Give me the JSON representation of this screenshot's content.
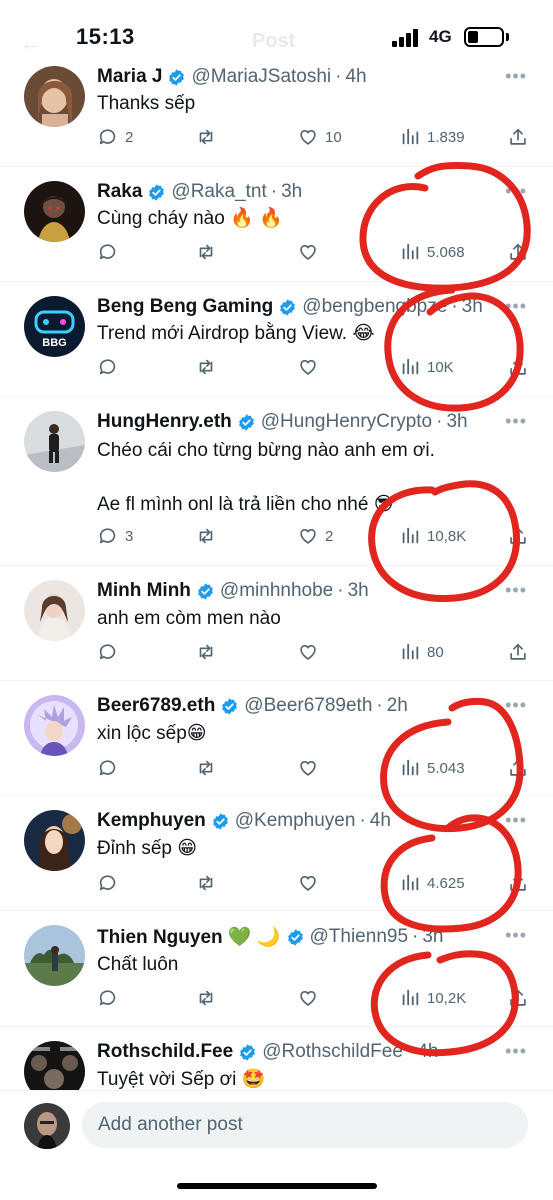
{
  "status_bar": {
    "time": "15:13",
    "network": "4G",
    "title": "Post"
  },
  "colors": {
    "verified": "#1d9bf0",
    "text": "#0f1419",
    "muted": "#536471",
    "annotation": "#e0261e"
  },
  "posts": [
    {
      "name": "Maria J",
      "handle": "@MariaJSatoshi",
      "time": "4h",
      "text": "Thanks sếp",
      "reply_count": "2",
      "repost_count": "",
      "like_count": "10",
      "views": "1.839"
    },
    {
      "name": "Raka",
      "handle": "@Raka_tnt",
      "time": "3h",
      "text": "Cùng cháy nào 🔥 🔥",
      "reply_count": "",
      "repost_count": "",
      "like_count": "",
      "views": "5.068"
    },
    {
      "name": "Beng Beng Gaming",
      "handle": "@bengbengbpze",
      "time": "3h",
      "text": "Trend mới Airdrop bằng View. 😂",
      "reply_count": "",
      "repost_count": "",
      "like_count": "",
      "views": "10K"
    },
    {
      "name": "HungHenry.eth",
      "handle": "@HungHenryCrypto",
      "time": "3h",
      "text": "Chéo cái cho từng bừng nào anh em ơi.\n\nAe fl mình onl là trả liền cho nhé 😎",
      "reply_count": "3",
      "repost_count": "",
      "like_count": "2",
      "views": "10,8K"
    },
    {
      "name": "Minh Minh",
      "handle": "@minhnhobe",
      "time": "3h",
      "text": "anh em còm men nào",
      "reply_count": "",
      "repost_count": "",
      "like_count": "",
      "views": "80"
    },
    {
      "name": "Beer6789.eth",
      "handle": "@Beer6789eth",
      "time": "2h",
      "text": "xin lộc sếp😁",
      "reply_count": "",
      "repost_count": "",
      "like_count": "",
      "views": "5.043"
    },
    {
      "name": "Kemphuyen",
      "handle": "@Kemphuyen",
      "time": "4h",
      "text": "Đỉnh sếp 😁",
      "reply_count": "",
      "repost_count": "",
      "like_count": "",
      "views": "4.625"
    },
    {
      "name": "Thien Nguyen 💚 🌙",
      "handle": "@Thienn95",
      "time": "3h",
      "text": "Chất luôn",
      "reply_count": "",
      "repost_count": "",
      "like_count": "",
      "views": "10,2K"
    },
    {
      "name": "Rothschild.Fee",
      "handle": "@RothschildFee",
      "time": "4h",
      "text": "Tuyệt vời Sếp ơi 🤩",
      "reply_count": "",
      "repost_count": "",
      "like_count": "",
      "views": ""
    }
  ],
  "composer": {
    "placeholder": "Add another post"
  },
  "icons": {
    "reply": "speech-bubble-icon",
    "repost": "repost-arrows-icon",
    "like": "heart-icon",
    "views": "bar-chart-icon",
    "share": "share-upload-icon",
    "verified": "verified-badge-icon",
    "more": "more-dots-icon"
  }
}
